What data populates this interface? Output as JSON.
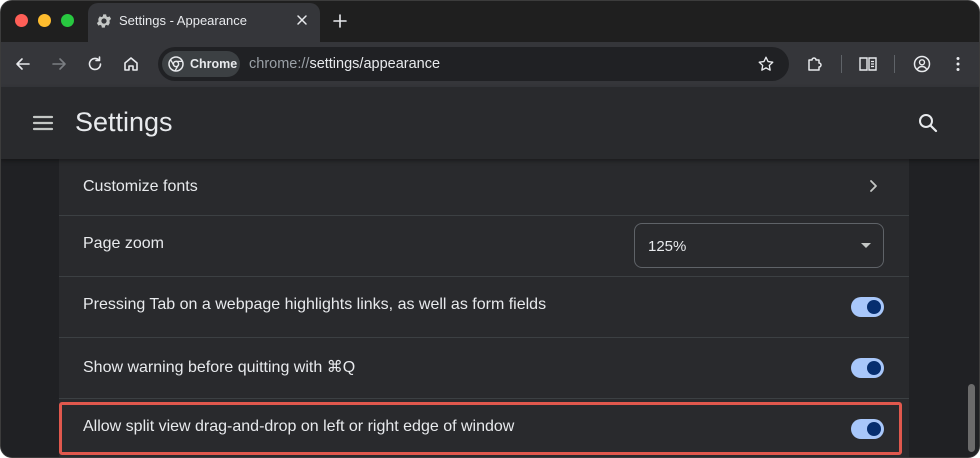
{
  "tab": {
    "title": "Settings - Appearance",
    "icon": "gear-icon"
  },
  "omnibox": {
    "chip_label": "Chrome",
    "url_prefix": "chrome://",
    "url_highlight": "settings",
    "url_suffix": "/appearance"
  },
  "header": {
    "title": "Settings"
  },
  "rows": {
    "customize_fonts": {
      "label": "Customize fonts"
    },
    "page_zoom": {
      "label": "Page zoom",
      "value": "125%"
    },
    "tab_highlight": {
      "label": "Pressing Tab on a webpage highlights links, as well as form fields",
      "enabled": true
    },
    "quit_warning": {
      "label": "Show warning before quitting with ⌘Q",
      "enabled": true
    },
    "split_view": {
      "label": "Allow split view drag-and-drop on left or right edge of window",
      "enabled": true
    }
  },
  "colors": {
    "accent_toggle_track": "#a8c7fa",
    "accent_toggle_knob": "#062e6f",
    "highlight_border": "#e0584d"
  }
}
